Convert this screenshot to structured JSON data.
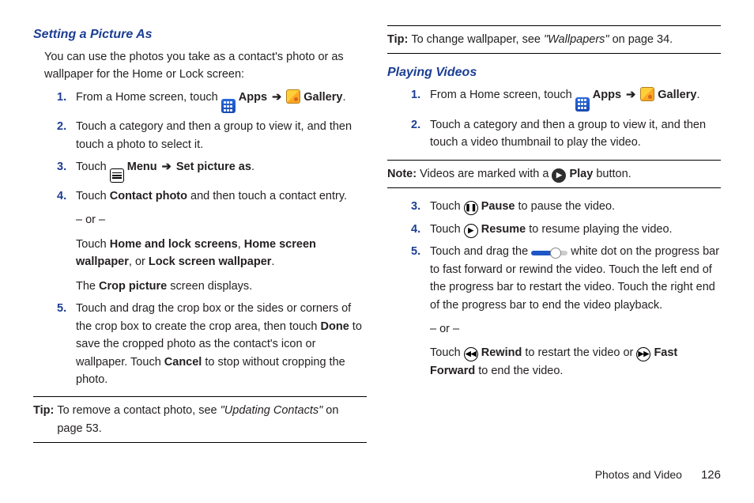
{
  "left": {
    "heading": "Setting a Picture As",
    "intro": "You can use the photos you take as a contact's photo or as wallpaper for the Home or Lock screen:",
    "li1a": "From a Home screen, touch ",
    "apps": "Apps",
    "arrow": "➔",
    "gallery": "Gallery",
    "period": ".",
    "li2": "Touch a category and then a group to view it, and then touch a photo to select it.",
    "li3a": "Touch ",
    "menu": "Menu",
    "setpic": "Set picture as",
    "li4a": "Touch ",
    "contactphoto": "Contact photo",
    "li4b": " and then touch a contact entry.",
    "or": "– or –",
    "li4c": "Touch ",
    "hls": "Home and lock screens",
    "comma": ", ",
    "hsw": "Home screen wallpaper",
    "cor": ", or ",
    "lsw": "Lock screen wallpaper",
    "li4d": "The ",
    "crop": "Crop picture",
    "li4e": " screen displays.",
    "li5a": "Touch and drag the crop box or the sides or corners of the crop box to create the crop area, then touch ",
    "done": "Done",
    "li5b": " to save the cropped photo as the contact's icon or wallpaper. Touch ",
    "cancel": "Cancel",
    "li5c": " to stop without cropping the photo.",
    "tiplabel": "Tip:",
    "tipa": " To remove a contact photo, see ",
    "tipi": "\"Updating Contacts\"",
    "tipb": " on page 53."
  },
  "right": {
    "tiplabel": "Tip:",
    "tipa": " To change wallpaper, see ",
    "tipi": "\"Wallpapers\"",
    "tipb": " on page 34.",
    "heading": "Playing Videos",
    "li1a": "From a Home screen, touch ",
    "apps": "Apps",
    "arrow": "➔",
    "gallery": "Gallery",
    "period": ".",
    "li2": "Touch a category and then a group to view it, and then touch a video thumbnail to play the video.",
    "notelabel": "Note:",
    "notea": " Videos are marked with a ",
    "play": "Play",
    "noteb": " button.",
    "li3a": "Touch ",
    "pause": "Pause",
    "li3b": " to pause the video.",
    "li4a": "Touch ",
    "resume": "Resume",
    "li4b": " to resume playing the video.",
    "li5a": "Touch and drag the ",
    "li5b": " white dot on the progress bar to fast forward or rewind the video. Touch the left end of the progress bar to restart the video. Touch the right end of the progress bar to end the video playback.",
    "or": "– or –",
    "li5c": "Touch ",
    "rewind": "Rewind",
    "li5d": " to restart the video or ",
    "ff": "Fast Forward",
    "li5e": " to end the video."
  },
  "footer": {
    "section": "Photos and Video",
    "page": "126"
  }
}
